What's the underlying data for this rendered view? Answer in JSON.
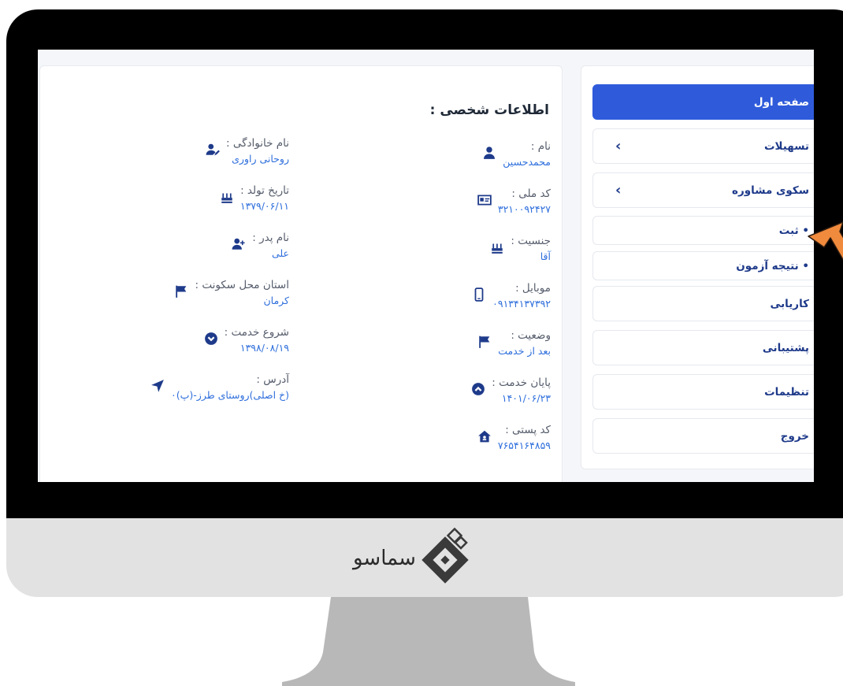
{
  "card": {
    "title": "اطلاعات شخصی :"
  },
  "fields_right": [
    {
      "label": "نام :",
      "value": "محمدحسین",
      "icon": "user-icon"
    },
    {
      "label": "کد ملی :",
      "value": "۳۲۱۰۰۹۲۴۲۷",
      "icon": "id-card-icon"
    },
    {
      "label": "جنسیت :",
      "value": "آقا",
      "icon": "cake-icon"
    },
    {
      "label": "موبایل :",
      "value": "۰۹۱۳۴۱۳۷۳۹۲",
      "icon": "mobile-icon"
    },
    {
      "label": "وضعیت :",
      "value": "بعد از خدمت",
      "icon": "flag-icon"
    },
    {
      "label": "پایان خدمت :",
      "value": "۱۴۰۱/۰۶/۲۳",
      "icon": "chevron-circle-up-icon"
    },
    {
      "label": "کد پستی :",
      "value": "۷۶۵۴۱۶۴۸۵۹",
      "icon": "house-icon"
    }
  ],
  "fields_left": [
    {
      "label": "نام خانوادگی :",
      "value": "روحانی راوری",
      "icon": "user-pen-icon"
    },
    {
      "label": "تاریخ تولد :",
      "value": "۱۳۷۹/۰۶/۱۱",
      "icon": "cake-icon"
    },
    {
      "label": "نام پدر :",
      "value": "علی",
      "icon": "user-plus-icon"
    },
    {
      "label": "استان محل سکونت :",
      "value": "کرمان",
      "icon": "flag-icon"
    },
    {
      "label": "شروع خدمت :",
      "value": "۱۳۹۸/۰۸/۱۹",
      "icon": "chevron-circle-down-icon"
    },
    {
      "label": "آدرس :",
      "value": "(خ اصلی)روستای طرز-(پ)۰",
      "icon": "location-arrow-icon"
    }
  ],
  "sidebar": {
    "items": [
      {
        "label": "صفحه اول",
        "active": true,
        "chevron": ""
      },
      {
        "label": "تسهیلات",
        "active": false,
        "chevron": "‹"
      },
      {
        "label": "سکوی مشاوره",
        "active": false,
        "chevron": "‹"
      },
      {
        "label": "• ثبت",
        "active": false,
        "chevron": ""
      },
      {
        "label": "• نتیجه آزمون",
        "active": false,
        "chevron": ""
      },
      {
        "label": "کاریابی",
        "active": false,
        "chevron": ""
      },
      {
        "label": "پشتیبانی",
        "active": false,
        "chevron": ""
      },
      {
        "label": "تنظیمات",
        "active": false,
        "chevron": ""
      },
      {
        "label": "خروج",
        "active": false,
        "chevron": ""
      }
    ]
  },
  "brand": {
    "logo_text": "سماسو"
  },
  "colors": {
    "primary": "#2f5bdb",
    "nav_text": "#1e3a8a",
    "value_text": "#2f6fdc",
    "arrow": "#f08a3c",
    "bezel": "#000000",
    "chin": "#e2e2e2",
    "stand": "#b8b8b8"
  }
}
